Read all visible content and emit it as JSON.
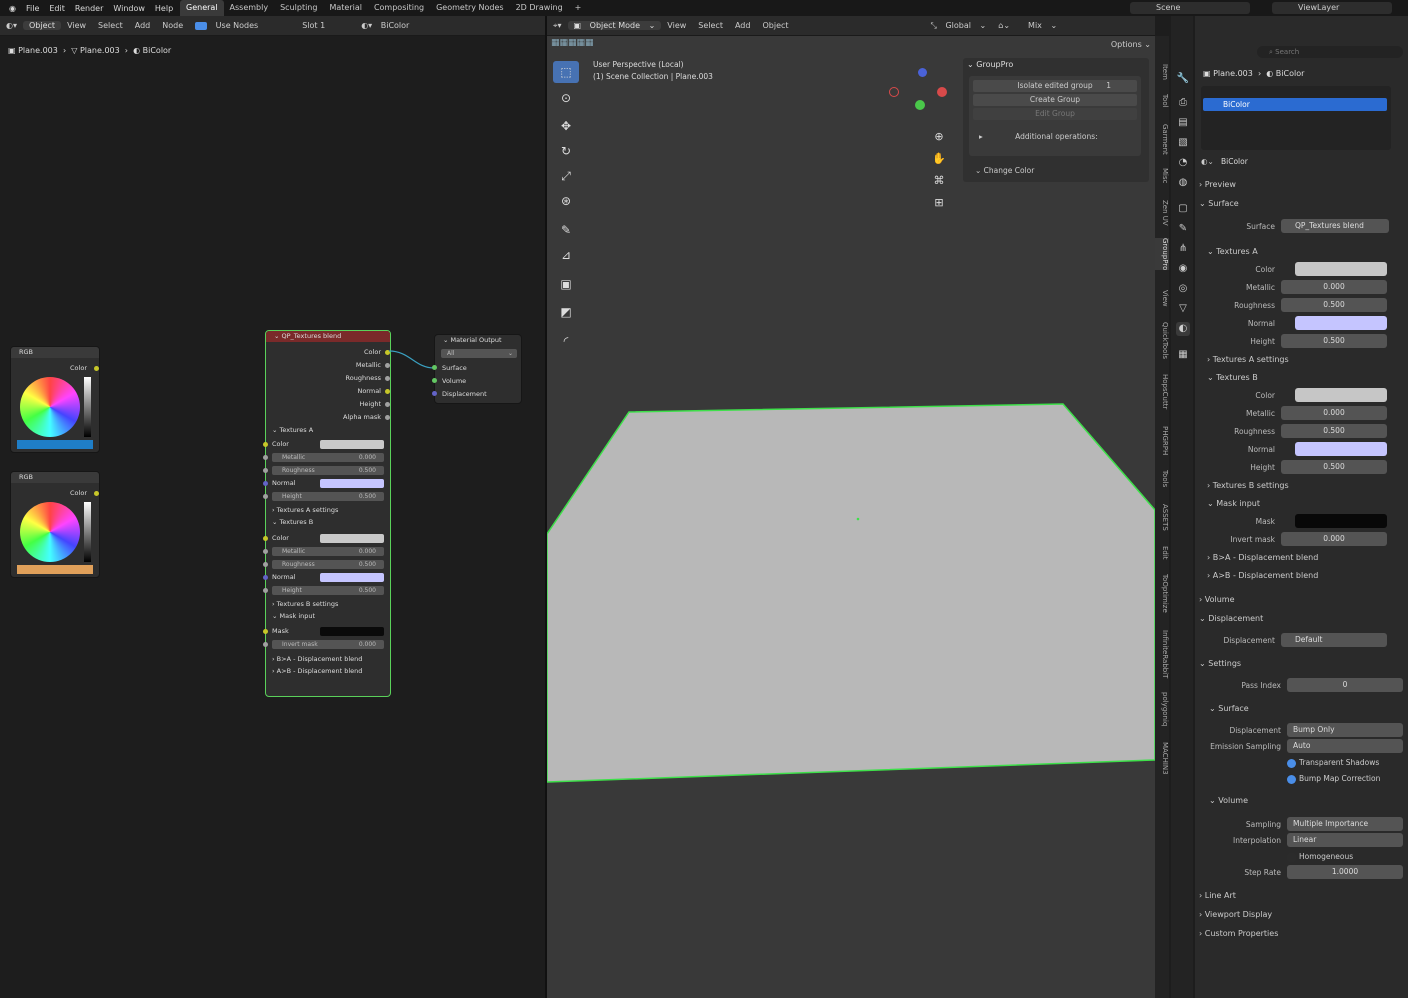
{
  "menu": {
    "file": "File",
    "edit": "Edit",
    "render": "Render",
    "window": "Window",
    "help": "Help"
  },
  "workspaces": [
    "General",
    "Assembly",
    "Sculpting",
    "Material",
    "Compositing",
    "Geometry Nodes",
    "2D Drawing"
  ],
  "scene": {
    "scene": "Scene",
    "viewlayer": "ViewLayer"
  },
  "nodeeditor": {
    "object": "Object",
    "view": "View",
    "select": "Select",
    "add": "Add",
    "node": "Node",
    "use_nodes": "Use Nodes",
    "slot": "Slot 1",
    "material": "BiColor",
    "breadcrumb": {
      "obj": "Plane.003",
      "mesh": "Plane.003",
      "mat": "BiColor"
    },
    "rgb1": {
      "title": "RGB",
      "out": "Color",
      "color": "#1f7ec7"
    },
    "rgb2": {
      "title": "RGB",
      "out": "Color",
      "color": "#e0a05a"
    },
    "group": {
      "title": "QP_Textures blend",
      "outputs": [
        "Color",
        "Metallic",
        "Roughness",
        "Normal",
        "Height",
        "Alpha mask"
      ],
      "texA": "Textures A",
      "texAset": "Textures A settings",
      "texB": "Textures B",
      "texBset": "Textures B settings",
      "mask": "Mask input",
      "color": "Color",
      "metallic": "Metallic",
      "roughness": "Roughness",
      "normal": "Normal",
      "height": "Height",
      "maskl": "Mask",
      "invert": "Invert mask",
      "v0": "0.000",
      "v5": "0.500",
      "ba": "B>A - Displacement blend",
      "ab": "A>B - Displacement blend"
    },
    "output": {
      "title": "Material Output",
      "target": "All",
      "surface": "Surface",
      "volume": "Volume",
      "displacement": "Displacement"
    }
  },
  "viewport": {
    "mode": "Object Mode",
    "view": "View",
    "select": "Select",
    "add": "Add",
    "object": "Object",
    "orient": "Global",
    "mix": "Mix",
    "options": "Options",
    "persp": "User Perspective (Local)",
    "coll": "(1) Scene Collection | Plane.003",
    "gp": {
      "title": "GroupPro",
      "isolate": "Isolate edited group",
      "count": "1",
      "create": "Create Group",
      "edit": "Edit Group",
      "addops": "Additional operations:",
      "change": "Change Color"
    }
  },
  "vtabs": [
    "Item",
    "Tool",
    "Garment",
    "Misc",
    "Zen UV",
    "GroupPro",
    "View",
    "QuickTools",
    "HopsCuttr",
    "PHGRPH",
    "Tools",
    "ASSETS",
    "Edit",
    "ToOptimize",
    "InfiniteRabbiT",
    "polygoniq",
    "MACHIN3"
  ],
  "props": {
    "search": "Search",
    "bc_obj": "Plane.003",
    "bc_mat": "BiColor",
    "slot": "BiColor",
    "matname": "BiColor",
    "preview": "Preview",
    "surface": "Surface",
    "surfacel": "Surface",
    "surfacev": "QP_Textures blend",
    "texA": "Textures A",
    "texAset": "Textures A settings",
    "texB": "Textures B",
    "texBset": "Textures B settings",
    "maskin": "Mask input",
    "color": "Color",
    "metallic": "Metallic",
    "roughness": "Roughness",
    "normal": "Normal",
    "height": "Height",
    "mask": "Mask",
    "invert": "Invert mask",
    "v0": "0.000",
    "v5": "0.500",
    "ba": "B>A - Displacement blend",
    "ab": "A>B - Displacement blend",
    "volume": "Volume",
    "displacement": "Displacement",
    "displ": "Displacement",
    "displv": "Default",
    "settings": "Settings",
    "pass": "Pass Index",
    "passv": "0",
    "ssurface": "Surface",
    "sdispl": "Displacement",
    "sdisplv": "Bump Only",
    "emis": "Emission Sampling",
    "emisv": "Auto",
    "trans": "Transparent Shadows",
    "bump": "Bump Map Correction",
    "svolume": "Volume",
    "sampling": "Sampling",
    "samplingv": "Multiple Importance",
    "interp": "Interpolation",
    "interpv": "Linear",
    "homog": "Homogeneous",
    "step": "Step Rate",
    "stepv": "1.0000",
    "lineart": "Line Art",
    "vdisp": "Viewport Display",
    "custom": "Custom Properties"
  }
}
